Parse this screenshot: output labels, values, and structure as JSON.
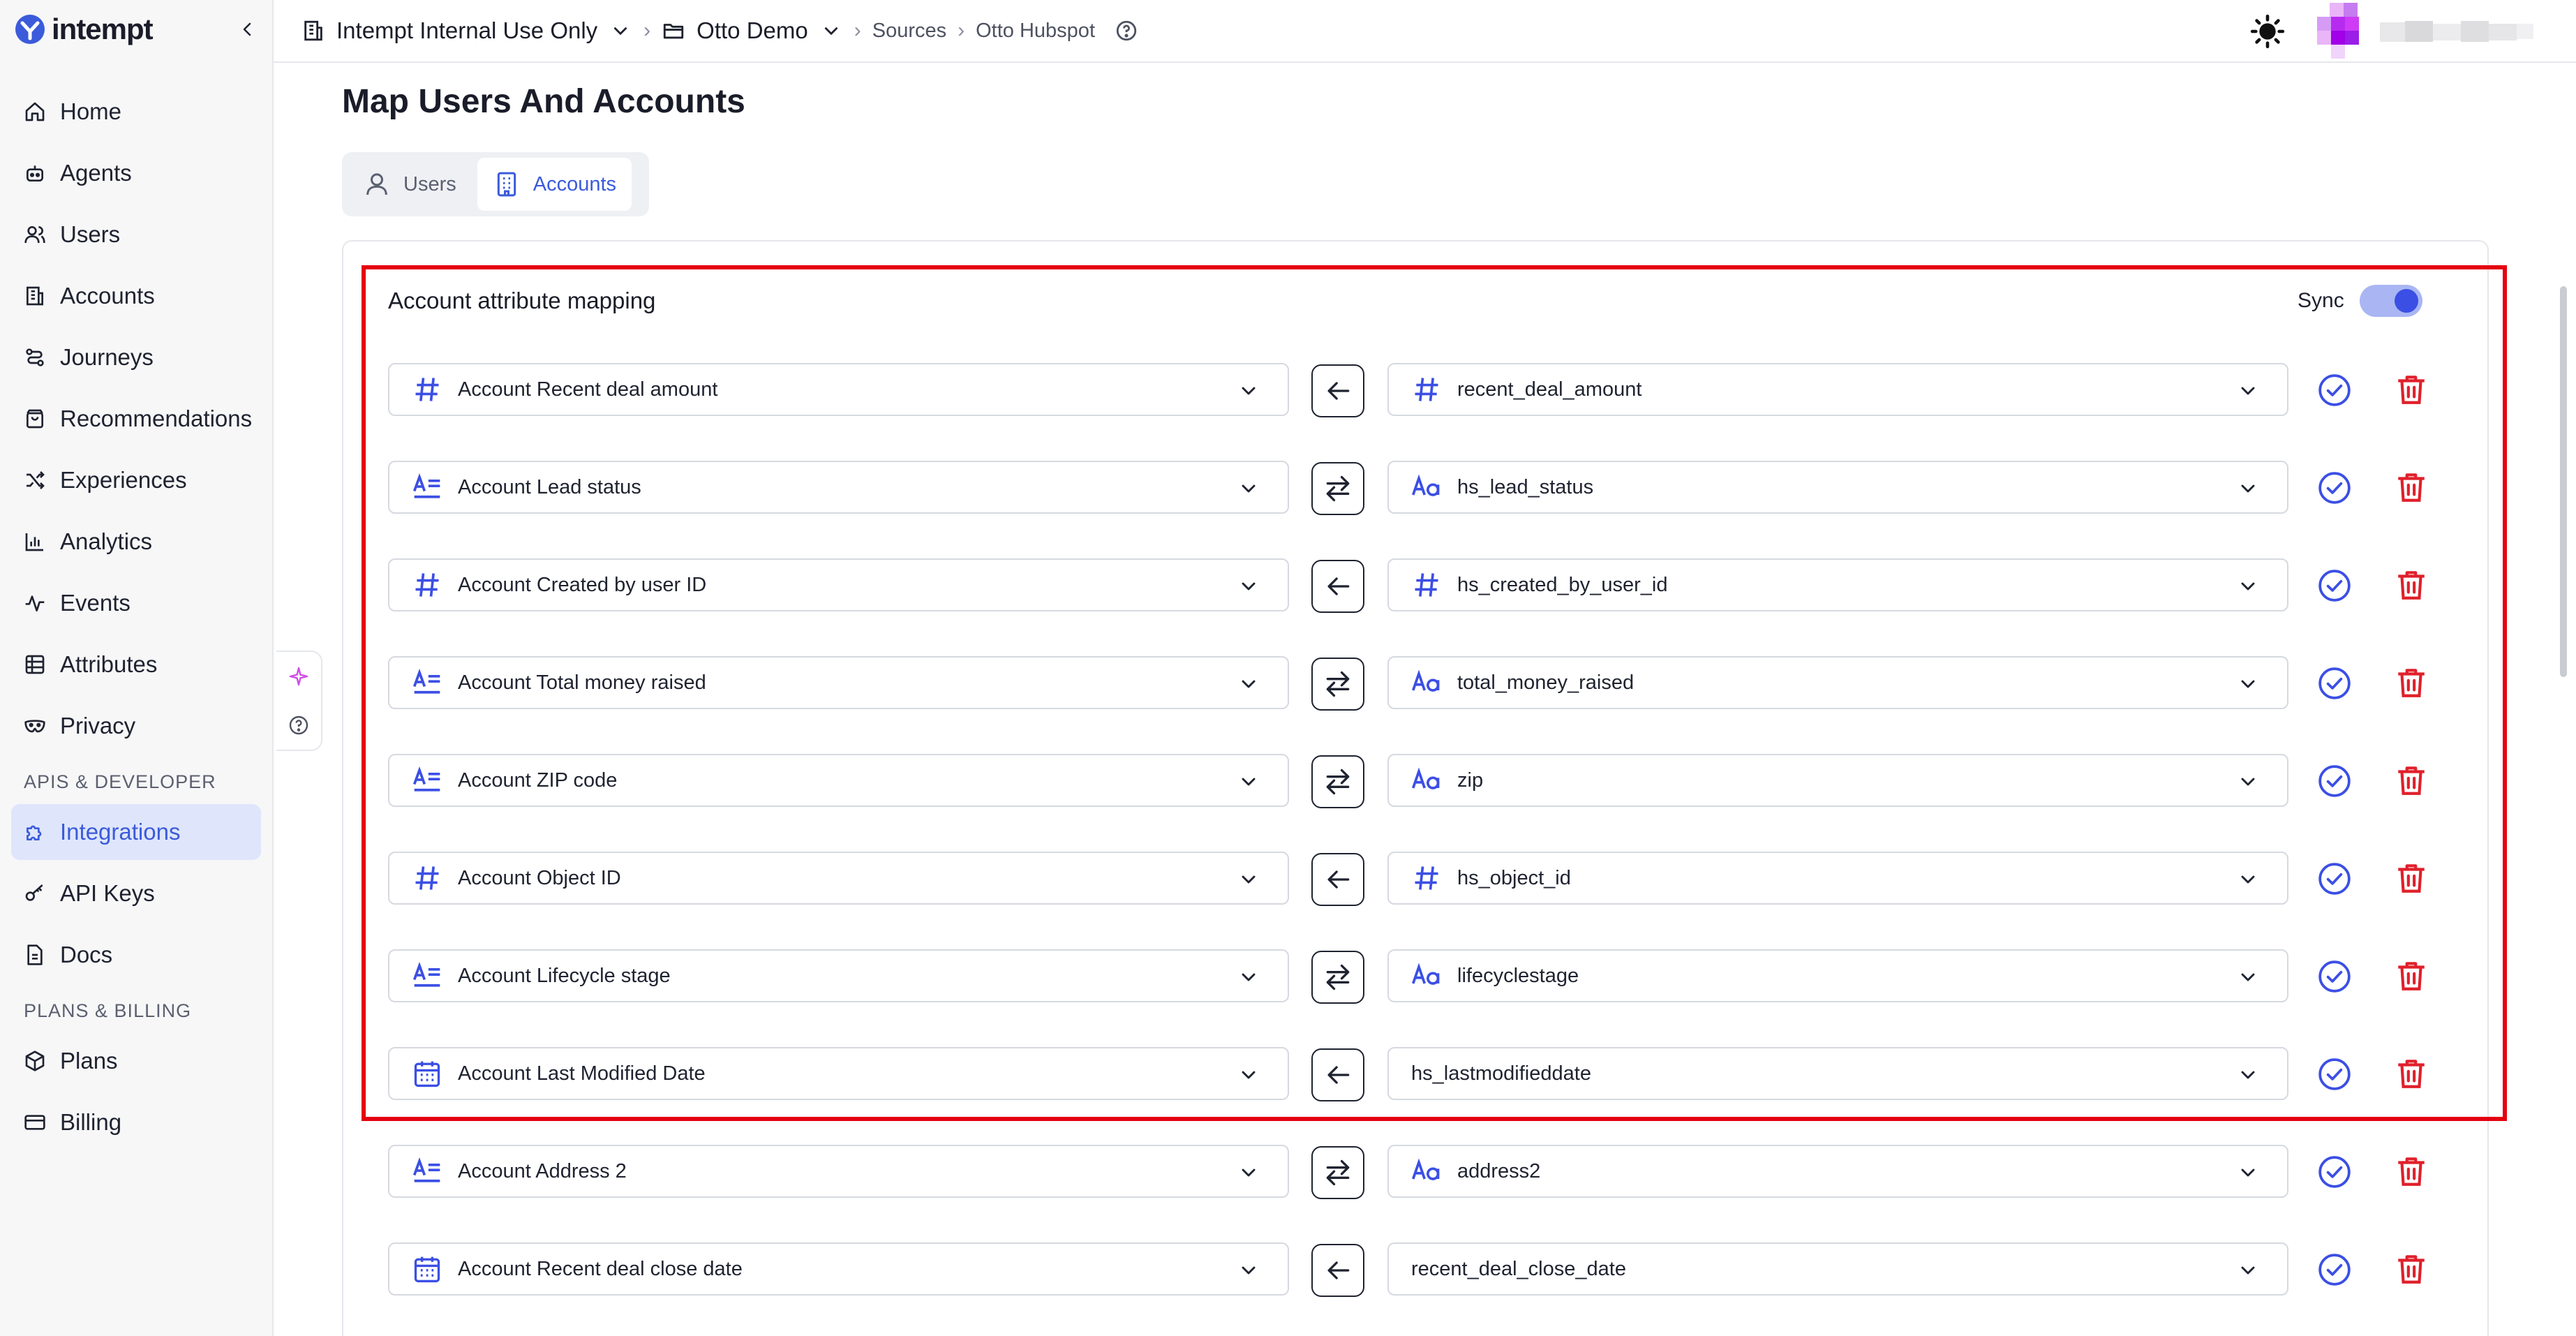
{
  "app": {
    "logo_text": "intempt"
  },
  "colors": {
    "accent": "#3b5bdb",
    "danger": "#e0202b",
    "highlight": "#e4000f"
  },
  "sidebar": {
    "items": [
      {
        "label": "Home",
        "icon": "home-icon"
      },
      {
        "label": "Agents",
        "icon": "robot-icon"
      },
      {
        "label": "Users",
        "icon": "users-icon"
      },
      {
        "label": "Accounts",
        "icon": "building-icon"
      },
      {
        "label": "Journeys",
        "icon": "route-icon"
      },
      {
        "label": "Recommendations",
        "icon": "bag-icon"
      },
      {
        "label": "Experiences",
        "icon": "shuffle-icon"
      },
      {
        "label": "Analytics",
        "icon": "bar-chart-icon"
      },
      {
        "label": "Events",
        "icon": "activity-icon"
      },
      {
        "label": "Attributes",
        "icon": "table-icon"
      }
    ],
    "privacy": {
      "label": "Privacy",
      "icon": "mask-icon"
    },
    "section_dev": "APIS & DEVELOPER",
    "dev_items": [
      {
        "label": "Integrations",
        "icon": "puzzle-icon",
        "active": true
      },
      {
        "label": "API Keys",
        "icon": "key-icon"
      },
      {
        "label": "Docs",
        "icon": "doc-icon"
      }
    ],
    "section_billing": "PLANS & BILLING",
    "billing_items": [
      {
        "label": "Plans",
        "icon": "box-icon"
      },
      {
        "label": "Billing",
        "icon": "card-icon"
      }
    ]
  },
  "topbar": {
    "org": "Intempt Internal Use Only",
    "project": "Otto Demo",
    "crumb1": "Sources",
    "crumb2": "Otto Hubspot"
  },
  "page": {
    "title": "Map Users And Accounts",
    "tabs": [
      {
        "label": "Users",
        "active": false
      },
      {
        "label": "Accounts",
        "active": true
      }
    ]
  },
  "mapping": {
    "title": "Account attribute mapping",
    "sync_label": "Sync",
    "sync_on": true,
    "rows": [
      {
        "left_type": "number",
        "left": "Account Recent deal amount",
        "direction": "left",
        "right_type": "number",
        "right": "recent_deal_amount"
      },
      {
        "left_type": "text",
        "left": "Account Lead status",
        "direction": "both",
        "right_type": "string",
        "right": "hs_lead_status"
      },
      {
        "left_type": "number",
        "left": "Account Created by user ID",
        "direction": "left",
        "right_type": "number",
        "right": "hs_created_by_user_id"
      },
      {
        "left_type": "text",
        "left": "Account Total money raised",
        "direction": "both",
        "right_type": "string",
        "right": "total_money_raised"
      },
      {
        "left_type": "text",
        "left": "Account ZIP code",
        "direction": "both",
        "right_type": "string",
        "right": "zip"
      },
      {
        "left_type": "number",
        "left": "Account Object ID",
        "direction": "left",
        "right_type": "number",
        "right": "hs_object_id"
      },
      {
        "left_type": "text",
        "left": "Account Lifecycle stage",
        "direction": "both",
        "right_type": "string",
        "right": "lifecyclestage"
      },
      {
        "left_type": "date",
        "left": "Account Last Modified Date",
        "direction": "left",
        "right_type": "none",
        "right": "hs_lastmodifieddate"
      },
      {
        "left_type": "text",
        "left": "Account Address 2",
        "direction": "both",
        "right_type": "string",
        "right": "address2"
      },
      {
        "left_type": "date",
        "left": "Account Recent deal close date",
        "direction": "left",
        "right_type": "none",
        "right": "recent_deal_close_date"
      }
    ]
  }
}
